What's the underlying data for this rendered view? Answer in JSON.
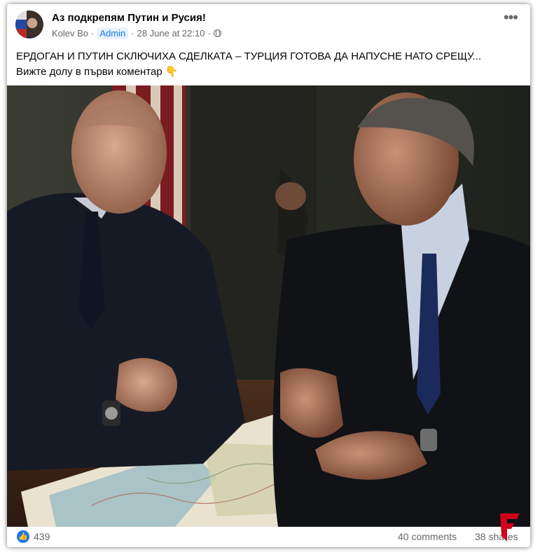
{
  "post": {
    "group_name": "Аз подкрепям Путин и Русия!",
    "author": "Kolev Bo",
    "separator": "·",
    "role_badge": "Admin",
    "timestamp": "28 June at 22:10",
    "separator2": "·",
    "privacy_icon": "globe-icon",
    "more_icon": "•••",
    "text_line1": "ЕРДОГАН И ПУТИН СКЛЮЧИХА СДЕЛКАТА – ТУРЦИЯ ГОТОВА ДА НАПУСНЕ НАТО СРЕЩУ...",
    "text_line2": "Вижте долу в първи коментар 👇"
  },
  "footer": {
    "like_icon": "👍",
    "like_count": "439",
    "comments": "40 comments",
    "shares": "38 shares"
  },
  "colors": {
    "accent": "#1877f2",
    "text": "#050505",
    "muted": "#65676b",
    "watermark": "#d0021b"
  }
}
